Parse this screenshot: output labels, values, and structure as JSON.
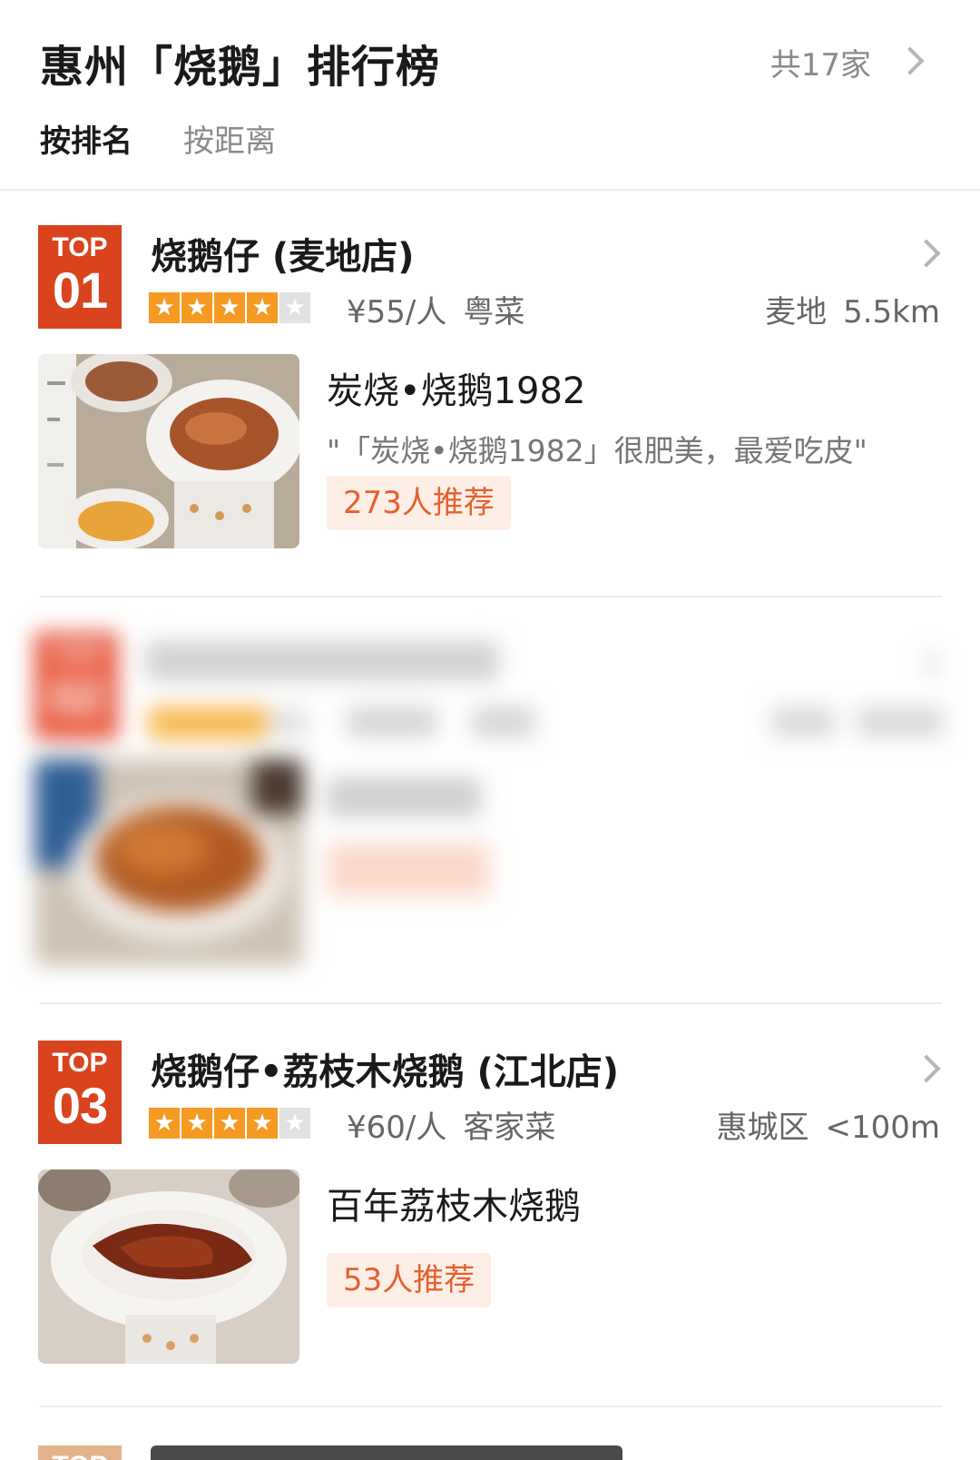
{
  "header": {
    "title": "惠州「烧鹅」排行榜",
    "count_text": "共17家",
    "sort_tabs": [
      {
        "label": "按排名",
        "active": true
      },
      {
        "label": "按距离",
        "active": false
      }
    ]
  },
  "listings": [
    {
      "badge_top": "TOP",
      "badge_rank": "01",
      "name": "烧鹅仔 (麦地店)",
      "rating_stars": 4,
      "price": "¥55/人",
      "cuisine": "粤菜",
      "area": "麦地",
      "distance": "5.5km",
      "dish": "炭烧•烧鹅1982",
      "quote": "\"「炭烧•烧鹅1982」很肥美，最爱吃皮\"",
      "recommend": "273人推荐",
      "blurred": false
    },
    {
      "badge_top": "TOP",
      "badge_rank": "02",
      "name": "",
      "rating_stars": 4,
      "price": "",
      "cuisine": "",
      "area": "",
      "distance": "",
      "dish": "",
      "quote": "",
      "recommend": "",
      "blurred": true
    },
    {
      "badge_top": "TOP",
      "badge_rank": "03",
      "name": "烧鹅仔•荔枝木烧鹅 (江北店)",
      "rating_stars": 4,
      "price": "¥60/人",
      "cuisine": "客家菜",
      "area": "惠城区",
      "distance": "<100m",
      "dish": "百年荔枝木烧鹅",
      "quote": "",
      "recommend": "53人推荐",
      "blurred": false
    },
    {
      "badge_top": "TOP",
      "badge_rank": "",
      "name": "",
      "blurred": false
    }
  ],
  "colors": {
    "badge": "#d9441f",
    "star": "#f59a23",
    "recommend_bg": "#fdeee6",
    "recommend_text": "#e4612f"
  }
}
